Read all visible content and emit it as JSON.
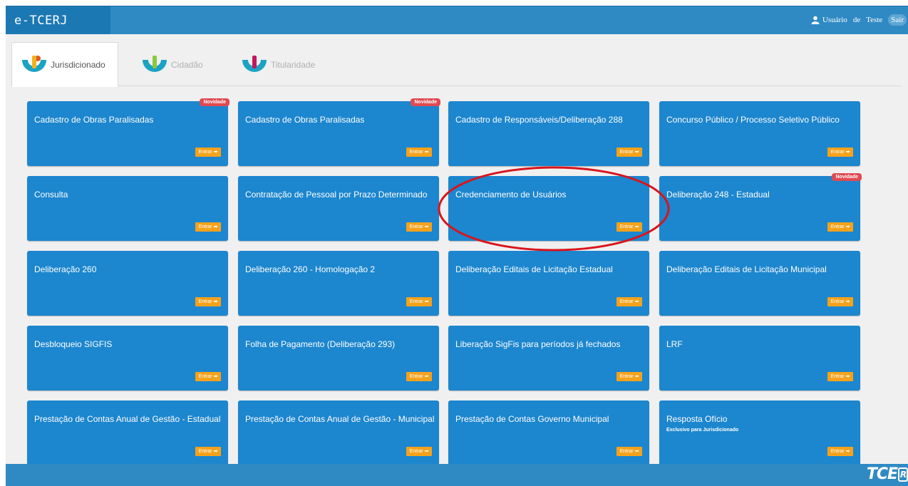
{
  "app": {
    "title": "e-TCERJ"
  },
  "user": {
    "icon": "user-icon",
    "word1": "Usuário",
    "word2": "de",
    "word3": "Teste",
    "logout": "Sair"
  },
  "tabs": [
    {
      "label": "Jurisdicionado",
      "active": true
    },
    {
      "label": "Cidadão",
      "active": false
    },
    {
      "label": "Titularidade",
      "active": false
    }
  ],
  "cards": [
    {
      "title": "Cadastro de Obras Paralisadas",
      "badge": "Novidade",
      "button": "Entrar ➡"
    },
    {
      "title": "Cadastro de Obras Paralisadas",
      "badge": "Novidade",
      "button": "Entrar ➡"
    },
    {
      "title": "Cadastro de Responsáveis/Deliberação 288",
      "button": "Entrar ➡"
    },
    {
      "title": "Concurso Público / Processo Seletivo Público",
      "button": "Entrar ➡"
    },
    {
      "title": "Consulta",
      "button": "Entrar ➡"
    },
    {
      "title": "Contratação de Pessoal por Prazo Determinado",
      "button": "Entrar ➡"
    },
    {
      "title": "Credenciamento de Usuários",
      "button": "Entrar ➡",
      "highlighted": true
    },
    {
      "title": "Deliberação 248 - Estadual",
      "badge": "Novidade",
      "button": "Entrar ➡"
    },
    {
      "title": "Deliberação 260",
      "button": "Entrar ➡"
    },
    {
      "title": "Deliberação 260 - Homologação 2",
      "button": "Entrar ➡"
    },
    {
      "title": "Deliberação Editais de Licitação Estadual",
      "button": "Entrar ➡"
    },
    {
      "title": "Deliberação Editais de Licitação Municipal",
      "button": "Entrar ➡"
    },
    {
      "title": "Desbloqueio SIGFIS",
      "button": "Entrar ➡"
    },
    {
      "title": "Folha de Pagamento (Deliberação 293)",
      "button": "Entrar ➡"
    },
    {
      "title": "Liberação SigFis para períodos já fechados",
      "button": "Entrar ➡"
    },
    {
      "title": "LRF",
      "button": "Entrar ➡"
    },
    {
      "title": "Prestação de Contas Anual de Gestão - Estadual",
      "button": "Entrar ➡"
    },
    {
      "title": "Prestação de Contas Anual de Gestão - Municipal",
      "button": "Entrar ➡"
    },
    {
      "title": "Prestação de Contas Governo Municipal",
      "button": "Entrar ➡"
    },
    {
      "title": "Resposta Ofício",
      "subtitle": "Exclusivo para Jurisdicionado",
      "button": "Entrar ➡"
    }
  ],
  "footer": {
    "logo_text": "TCE",
    "logo_mark": "R"
  },
  "colors": {
    "topbar": "#2f8ac4",
    "brand": "#1c78b3",
    "card": "#1c86ce",
    "enter_button": "#f5a21b",
    "badge": "#e04a52",
    "annotation": "#d9141c"
  }
}
